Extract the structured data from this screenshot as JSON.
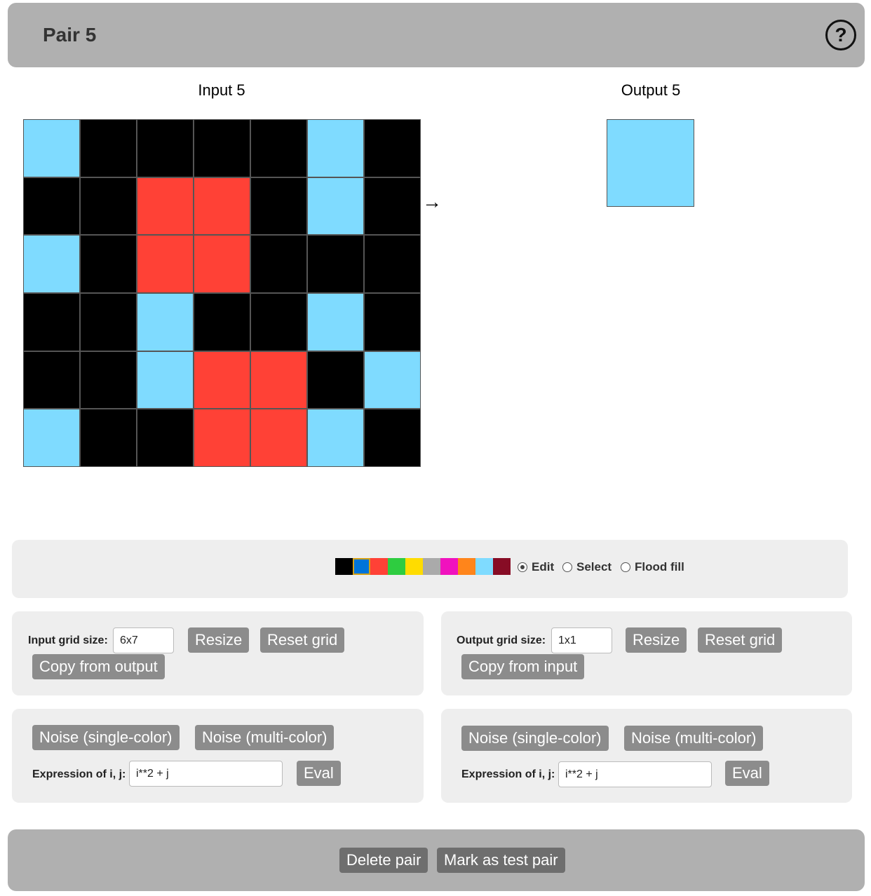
{
  "header": {
    "title": "Pair 5",
    "help_icon": "question-circle-icon"
  },
  "colors": {
    "0": "#000000",
    "1": "#0074d9",
    "2": "#ff4136",
    "3": "#2ecc40",
    "4": "#ffdc00",
    "5": "#aaaaaa",
    "6": "#f012be",
    "7": "#ff851b",
    "8": "#7fdbff",
    "9": "#870c25"
  },
  "input": {
    "label": "Input 5",
    "grid": [
      [
        8,
        0,
        0,
        0,
        0,
        8,
        0
      ],
      [
        0,
        0,
        2,
        2,
        0,
        8,
        0
      ],
      [
        8,
        0,
        2,
        2,
        0,
        0,
        0
      ],
      [
        0,
        0,
        8,
        0,
        0,
        8,
        0
      ],
      [
        0,
        0,
        8,
        2,
        2,
        0,
        8
      ],
      [
        8,
        0,
        0,
        2,
        2,
        8,
        0
      ]
    ]
  },
  "output": {
    "label": "Output 5",
    "grid": [
      [
        8
      ]
    ]
  },
  "arrow": "→",
  "palette": {
    "swatches": [
      0,
      1,
      2,
      3,
      4,
      5,
      6,
      7,
      8,
      9
    ],
    "selected": 1
  },
  "modes": [
    {
      "label": "Edit",
      "checked": true
    },
    {
      "label": "Select",
      "checked": false
    },
    {
      "label": "Flood fill",
      "checked": false
    }
  ],
  "input_controls": {
    "size_label": "Input grid size:",
    "size_value": "6x7",
    "resize": "Resize",
    "reset": "Reset grid",
    "copy": "Copy from output",
    "noise_single": "Noise (single-color)",
    "noise_multi": "Noise (multi-color)",
    "expr_label": "Expression of i, j:",
    "expr_value": "i**2 + j",
    "eval": "Eval"
  },
  "output_controls": {
    "size_label": "Output grid size:",
    "size_value": "1x1",
    "resize": "Resize",
    "reset": "Reset grid",
    "copy": "Copy from input",
    "noise_single": "Noise (single-color)",
    "noise_multi": "Noise (multi-color)",
    "expr_label": "Expression of i, j:",
    "expr_value": "i**2 + j",
    "eval": "Eval"
  },
  "footer": {
    "delete": "Delete pair",
    "mark_test": "Mark as test pair"
  }
}
